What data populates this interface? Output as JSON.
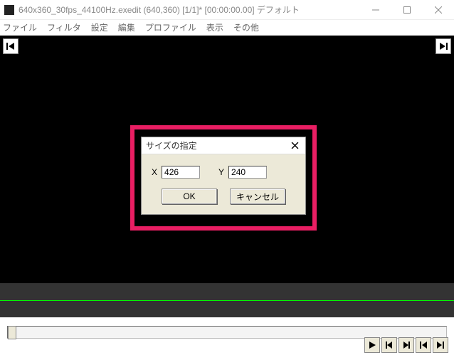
{
  "window": {
    "title": "640x360_30fps_44100Hz.exedit (640,360)  [1/1]* [00:00:00.00]  デフォルト"
  },
  "menu": {
    "items": [
      "ファイル",
      "フィルタ",
      "設定",
      "編集",
      "プロファイル",
      "表示",
      "その他"
    ]
  },
  "dialog": {
    "title": "サイズの指定",
    "x_label": "X",
    "x_value": "426",
    "y_label": "Y",
    "y_value": "240",
    "ok": "OK",
    "cancel": "キャンセル"
  }
}
